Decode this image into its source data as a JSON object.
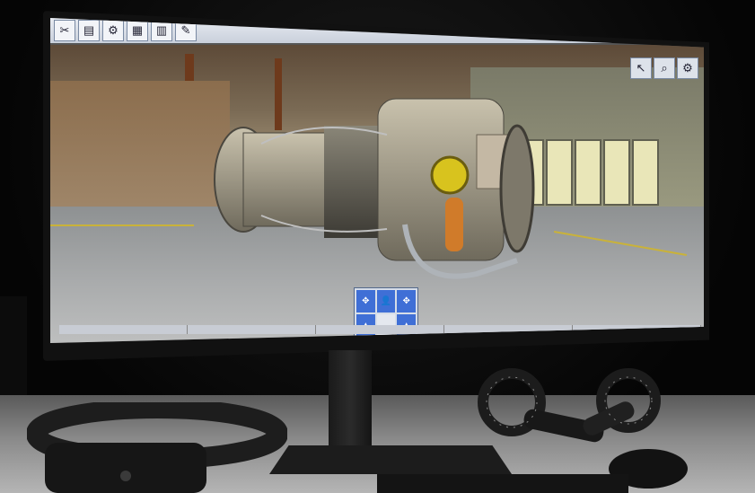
{
  "toolbar": {
    "buttons": [
      {
        "name": "tools-icon",
        "glyph": "✂"
      },
      {
        "name": "document-icon",
        "glyph": "▤"
      },
      {
        "name": "gear-icon",
        "glyph": "⚙"
      },
      {
        "name": "panel-icon",
        "glyph": "▦"
      },
      {
        "name": "book-icon",
        "glyph": "▥"
      },
      {
        "name": "wrench-icon",
        "glyph": "✎"
      }
    ],
    "right_buttons": [
      {
        "name": "select-icon",
        "glyph": "↖"
      },
      {
        "name": "zoom-icon",
        "glyph": "⌕"
      },
      {
        "name": "settings-icon",
        "glyph": "⚙"
      }
    ]
  },
  "nav_pad": {
    "cells": [
      "✥",
      "👤",
      "✥",
      "▲",
      "",
      "▲"
    ]
  },
  "tabs": [
    "",
    "",
    "",
    "",
    ""
  ],
  "colors": {
    "toolbar": "#dfe4ec",
    "nav_blue": "#3f6fd6",
    "floor_marking": "#c9b23a",
    "beam": "#6e3a1c"
  }
}
